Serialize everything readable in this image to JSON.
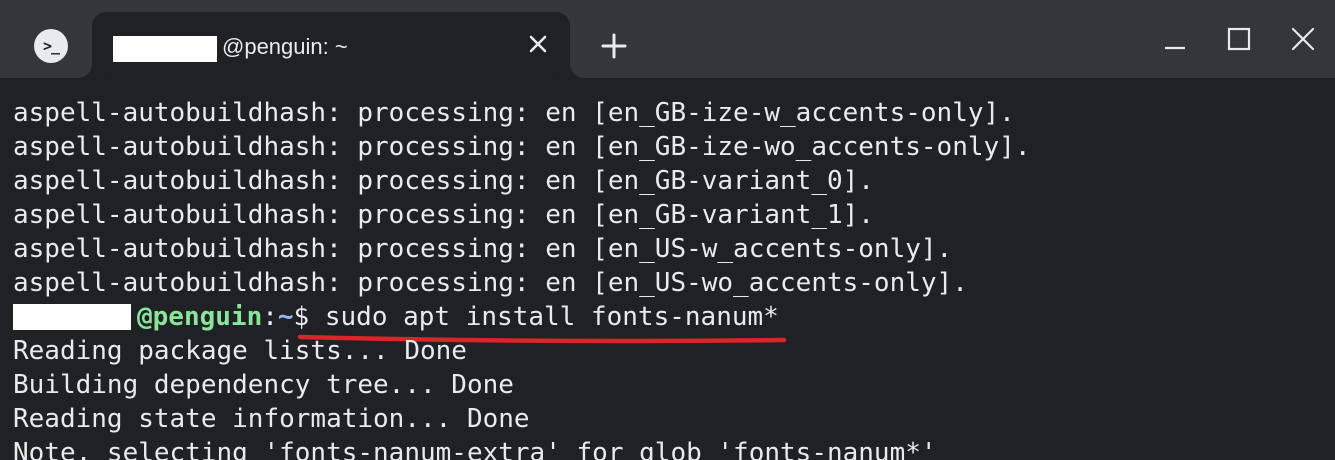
{
  "window": {
    "app_icon_glyph": ">_",
    "tab_title": "@penguin: ~",
    "new_tab_glyph": "+",
    "colors": {
      "titlebar": "#35363a",
      "background": "#202124",
      "text": "#e8eaed",
      "host": "#8ae49a",
      "path": "#9ab8f0",
      "annotation": "#d9262b"
    },
    "icons": [
      "terminal-icon",
      "tab-close-icon",
      "new-tab-icon",
      "minimize-icon",
      "maximize-icon",
      "close-window-icon"
    ]
  },
  "terminal": {
    "output_top": [
      "aspell-autobuildhash: processing: en [en_GB-ize-w_accents-only].",
      "aspell-autobuildhash: processing: en [en_GB-ize-wo_accents-only].",
      "aspell-autobuildhash: processing: en [en_GB-variant_0].",
      "aspell-autobuildhash: processing: en [en_GB-variant_1].",
      "aspell-autobuildhash: processing: en [en_US-w_accents-only].",
      "aspell-autobuildhash: processing: en [en_US-wo_accents-only]."
    ],
    "prompt": {
      "host": "@penguin",
      "sep": ":",
      "path": "~",
      "symbol": "$ ",
      "command": "sudo apt install fonts-nanum*"
    },
    "output_bottom": [
      "Reading package lists... Done",
      "Building dependency tree... Done",
      "Reading state information... Done",
      "Note, selecting 'fonts-nanum-extra' for glob 'fonts-nanum*'"
    ]
  }
}
